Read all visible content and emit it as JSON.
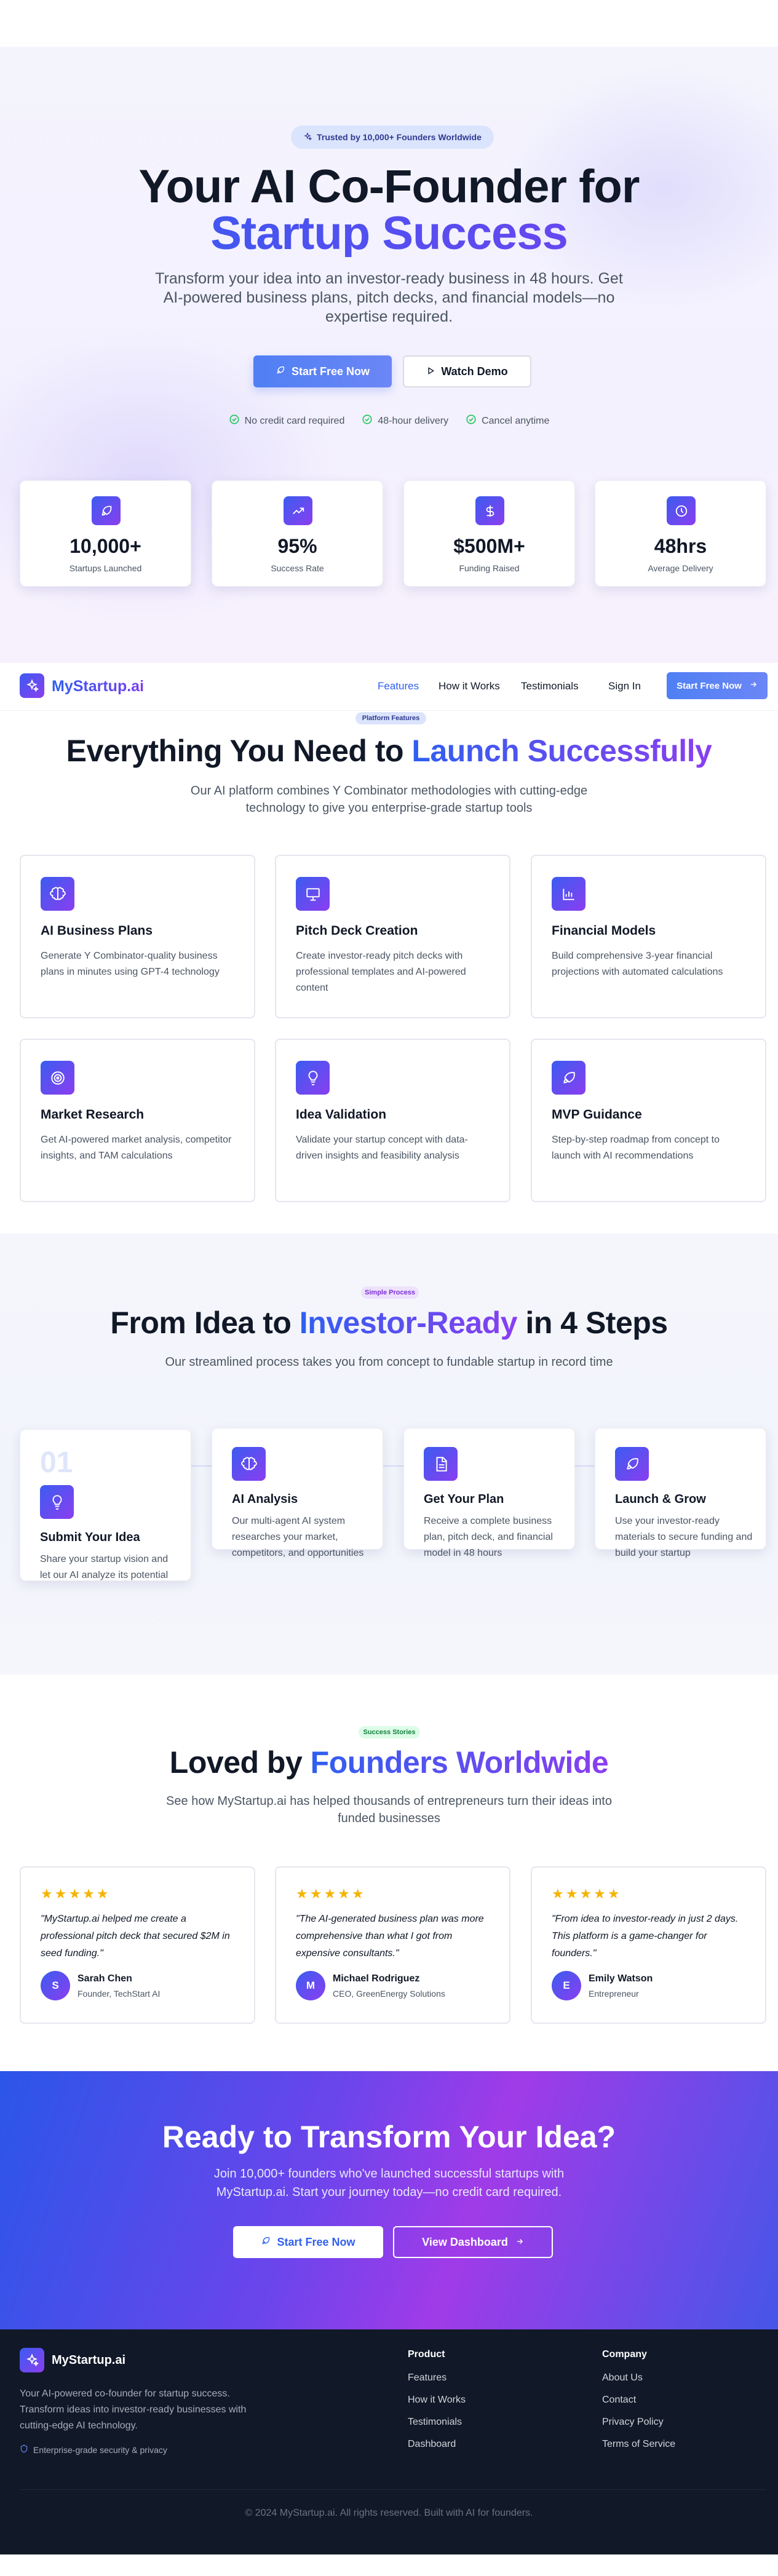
{
  "hero": {
    "badge": "Trusted by 10,000+ Founders Worldwide",
    "title_line1": "Your AI Co-Founder for",
    "title_line2": "Startup Success",
    "subtitle": "Transform your idea into an investor-ready business in 48 hours. Get AI-powered business plans, pitch decks, and financial models—no expertise required.",
    "primary_btn": "Start Free Now",
    "secondary_btn": "Watch Demo",
    "checks": [
      "No credit card required",
      "48-hour delivery",
      "Cancel anytime"
    ],
    "stats": [
      {
        "icon": "rocket-icon",
        "value": "10,000+",
        "label": "Startups Launched"
      },
      {
        "icon": "trending-up-icon",
        "value": "95%",
        "label": "Success Rate"
      },
      {
        "icon": "dollar-icon",
        "value": "$500M+",
        "label": "Funding Raised"
      },
      {
        "icon": "clock-icon",
        "value": "48hrs",
        "label": "Average Delivery"
      }
    ]
  },
  "nav": {
    "logo": "MyStartup.ai",
    "links": [
      "Features",
      "How it Works",
      "Testimonials"
    ],
    "signin": "Sign In",
    "cta": "Start Free Now"
  },
  "features": {
    "pill": "Platform Features",
    "title_plain": "Everything You Need to ",
    "title_accent": "Launch Successfully",
    "subtitle": "Our AI platform combines Y Combinator methodologies with cutting-edge technology to give you enterprise-grade startup tools",
    "items": [
      {
        "icon": "brain-icon",
        "title": "AI Business Plans",
        "desc": "Generate Y Combinator-quality business plans in minutes using GPT-4 technology"
      },
      {
        "icon": "presentation-icon",
        "title": "Pitch Deck Creation",
        "desc": "Create investor-ready pitch decks with professional templates and AI-powered content"
      },
      {
        "icon": "bar-chart-icon",
        "title": "Financial Models",
        "desc": "Build comprehensive 3-year financial projections with automated calculations"
      },
      {
        "icon": "target-icon",
        "title": "Market Research",
        "desc": "Get AI-powered market analysis, competitor insights, and TAM calculations"
      },
      {
        "icon": "lightbulb-icon",
        "title": "Idea Validation",
        "desc": "Validate your startup concept with data-driven insights and feasibility analysis"
      },
      {
        "icon": "rocket-icon",
        "title": "MVP Guidance",
        "desc": "Step-by-step roadmap from concept to launch with AI recommendations"
      }
    ]
  },
  "steps": {
    "pill": "Simple Process",
    "title_plain1": "From Idea to ",
    "title_accent": "Investor-Ready",
    "title_plain2": " in 4 Steps",
    "subtitle": "Our streamlined process takes you from concept to fundable startup in record time",
    "items": [
      {
        "number": "01",
        "icon": "lightbulb-icon",
        "title": "Submit Your Idea",
        "desc": "Share your startup vision and let our AI analyze its potential"
      },
      {
        "number": "",
        "icon": "brain-icon",
        "title": "AI Analysis",
        "desc": "Our multi-agent AI system researches your market, competitors, and opportunities"
      },
      {
        "number": "",
        "icon": "document-icon",
        "title": "Get Your Plan",
        "desc": "Receive a complete business plan, pitch deck, and financial model in 48 hours"
      },
      {
        "number": "",
        "icon": "rocket-icon",
        "title": "Launch & Grow",
        "desc": "Use your investor-ready materials to secure funding and build your startup"
      }
    ]
  },
  "testimonials": {
    "pill": "Success Stories",
    "title_plain": "Loved by ",
    "title_accent": "Founders Worldwide",
    "subtitle": "See how MyStartup.ai has helped thousands of entrepreneurs turn their ideas into funded businesses",
    "items": [
      {
        "stars": "★★★★★",
        "quote": "\"MyStartup.ai helped me create a professional pitch deck that secured $2M in seed funding.\"",
        "initial": "S",
        "name": "Sarah Chen",
        "role": "Founder, TechStart AI"
      },
      {
        "stars": "★★★★★",
        "quote": "\"The AI-generated business plan was more comprehensive than what I got from expensive consultants.\"",
        "initial": "M",
        "name": "Michael Rodriguez",
        "role": "CEO, GreenEnergy Solutions"
      },
      {
        "stars": "★★★★★",
        "quote": "\"From idea to investor-ready in just 2 days. This platform is a game-changer for founders.\"",
        "initial": "E",
        "name": "Emily Watson",
        "role": "Entrepreneur"
      }
    ]
  },
  "cta": {
    "title": "Ready to Transform Your Idea?",
    "subtitle": "Join 10,000+ founders who've launched successful startups with MyStartup.ai. Start your journey today—no credit card required.",
    "primary_btn": "Start Free Now",
    "secondary_btn": "View Dashboard"
  },
  "footer": {
    "logo": "MyStartup.ai",
    "desc": "Your AI-powered co-founder for startup success. Transform ideas into investor-ready businesses with cutting-edge AI technology.",
    "security": "Enterprise-grade security & privacy",
    "product_heading": "Product",
    "product_links": [
      "Features",
      "How it Works",
      "Testimonials",
      "Dashboard"
    ],
    "company_heading": "Company",
    "company_links": [
      "About Us",
      "Contact",
      "Privacy Policy",
      "Terms of Service"
    ],
    "copyright": "© 2024 MyStartup.ai. All rights reserved. Built with AI for founders."
  },
  "colors": {
    "brand_blue": "#2f5ff0",
    "brand_purple": "#8a3ef0",
    "footer_bg": "#111827",
    "star": "#f5b400",
    "check_green": "#22c55e"
  }
}
